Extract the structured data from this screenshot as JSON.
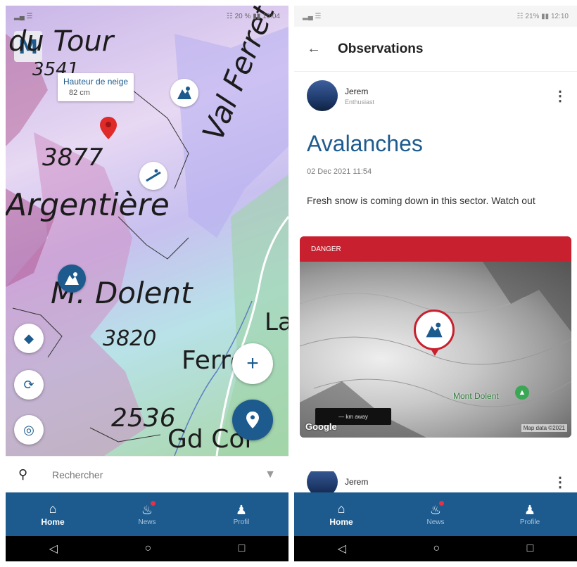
{
  "left": {
    "statusbar": {
      "left": "▂▄ ☰",
      "right": "☷ 20 % ▮▮ 10:04"
    },
    "map": {
      "logo": "M",
      "labels": {
        "tour": "du Tour",
        "alt_3541": "3541",
        "alt_3877": "3877",
        "argentiere": "Argentière",
        "val_ferret": "Val Ferret",
        "dolent": "M. Dolent",
        "alt_3820": "3820",
        "ferret": "Ferret",
        "alt_2536": "2536",
        "gd_col": "Gd Col",
        "la": "La"
      },
      "popup": {
        "title": "Hauteur de neige",
        "value": "82 cm"
      }
    },
    "search": {
      "placeholder": "Rechercher"
    },
    "tabs": [
      {
        "label": "Home"
      },
      {
        "label": "News"
      },
      {
        "label": "Profil"
      }
    ]
  },
  "right": {
    "statusbar": {
      "left": "▂▄ ☰",
      "right": "☷ 21% ▮▮ 12:10"
    },
    "appbar": {
      "back": "←",
      "title": "Observations"
    },
    "post": {
      "author": "Jerem",
      "role": "Enthusiast",
      "title": "Avalanches",
      "date": "02 Dec 2021 11:54",
      "text": "Fresh snow is coming down in this sector. Watch out",
      "danger_label": "DANGER",
      "place": "Mont Dolent",
      "google": "Google",
      "map_data": "Map data ©2021",
      "tooltip": "— km away"
    },
    "post2": {
      "author": "Jerem"
    },
    "tabs": [
      {
        "label": "Home"
      },
      {
        "label": "News"
      },
      {
        "label": "Profile"
      }
    ]
  },
  "colors": {
    "brand": "#1d5b8f",
    "danger": "#c9202f",
    "badge": "#e0334a"
  }
}
